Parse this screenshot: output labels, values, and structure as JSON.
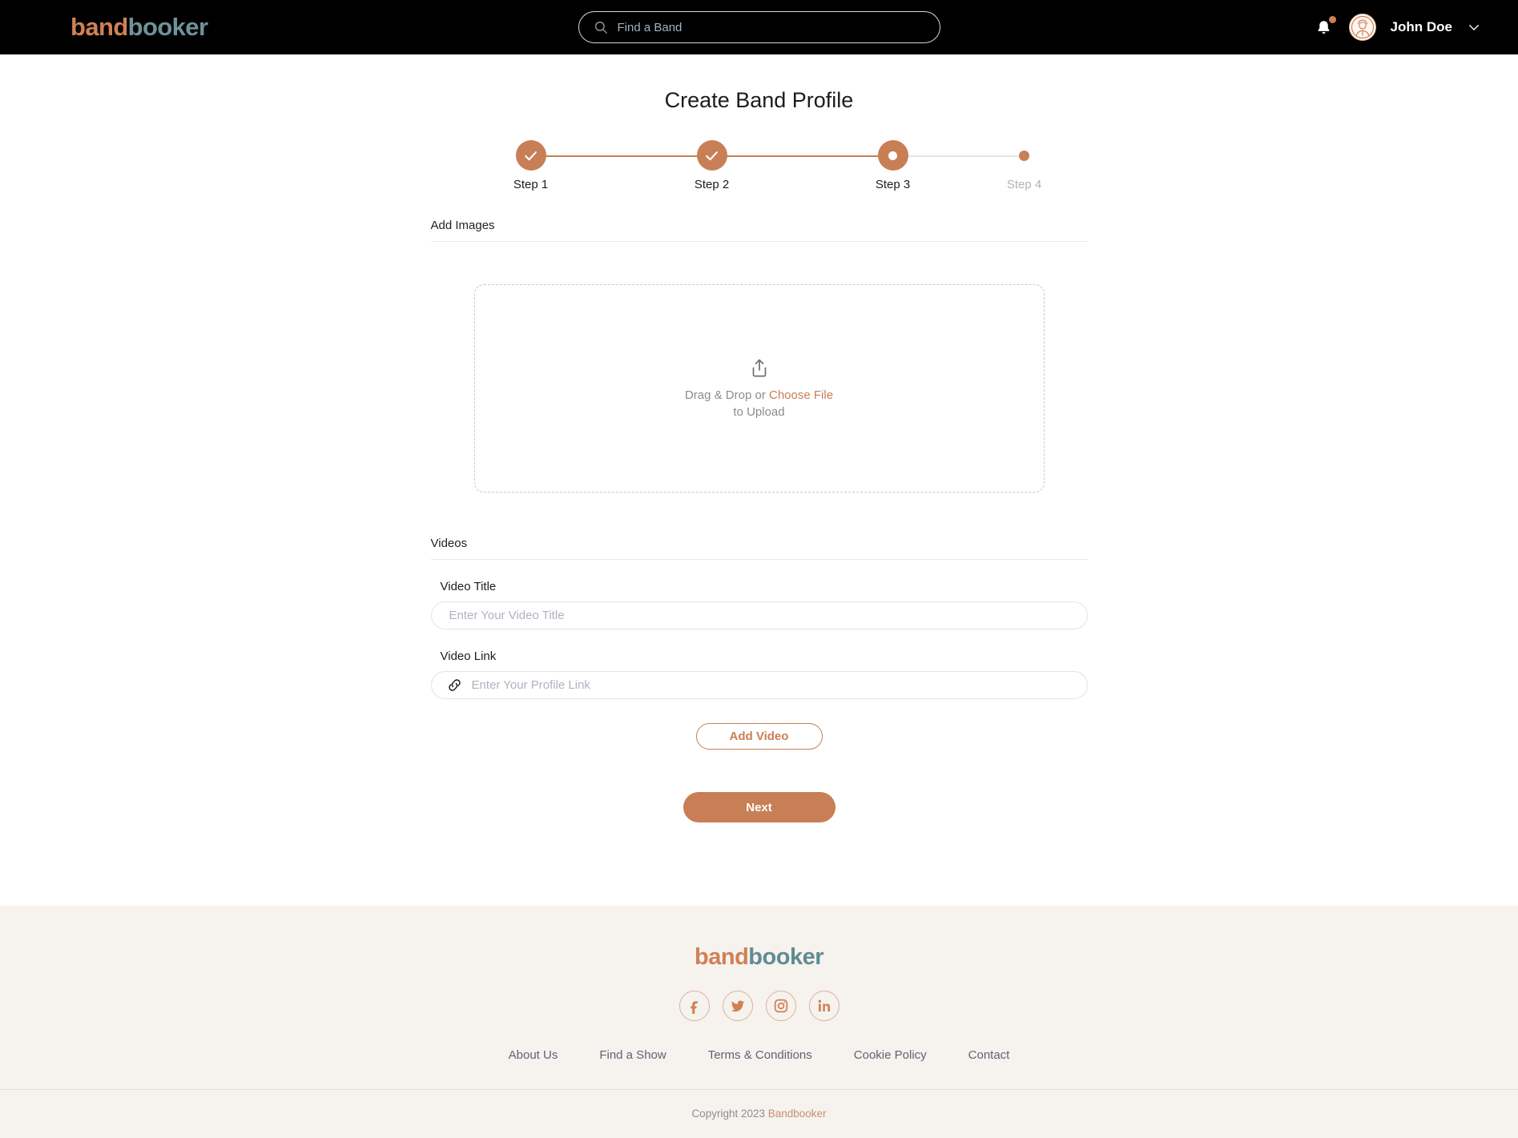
{
  "header": {
    "logo_part1": "band",
    "logo_part2": "booker",
    "search_placeholder": "Find a Band",
    "search_value": "",
    "username": "John Doe"
  },
  "main": {
    "page_title": "Create Band Profile",
    "stepper": [
      {
        "label": "Step 1",
        "state": "completed"
      },
      {
        "label": "Step 2",
        "state": "completed"
      },
      {
        "label": "Step 3",
        "state": "active"
      },
      {
        "label": "Step 4",
        "state": "upcoming"
      }
    ],
    "images_section_label": "Add Images",
    "dropzone": {
      "text_prefix": "Drag & Drop or ",
      "choose_file": "Choose File",
      "text_suffix": "to Upload"
    },
    "videos_section_label": "Videos",
    "video_title_label": "Video Title",
    "video_title_placeholder": "Enter Your Video Title",
    "video_title_value": "",
    "video_link_label": "Video Link",
    "video_link_placeholder": "Enter Your Profile Link",
    "video_link_value": "",
    "add_video_label": "Add Video",
    "next_label": "Next"
  },
  "footer": {
    "logo_part1": "band",
    "logo_part2": "booker",
    "socials": [
      "facebook-icon",
      "twitter-icon",
      "instagram-icon",
      "linkedin-icon"
    ],
    "links": [
      "About Us",
      "Find a Show",
      "Terms & Conditions",
      "Cookie Policy",
      "Contact"
    ],
    "copyright_text": "Copyright 2023 ",
    "copyright_brand": "Bandbooker"
  },
  "colors": {
    "accent": "#c87f55",
    "teal": "#6e929a",
    "header_bg": "#000000",
    "footer_bg": "#f6f2ee",
    "muted_text": "#b3b3b3"
  }
}
